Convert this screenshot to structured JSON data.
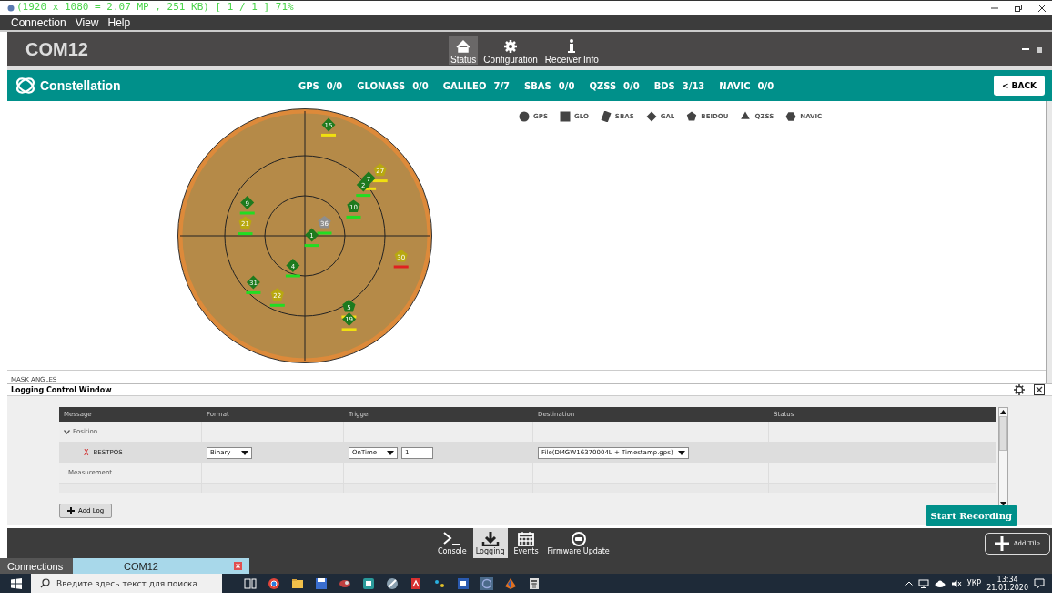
{
  "window": {
    "viewer_overlay": "(1920 x 1080 = 2.07 MP  ,  251 KB)  [ 1 / 1 ]  71%"
  },
  "menu": [
    "Connection",
    "View",
    "Help"
  ],
  "device": {
    "name": "COM12"
  },
  "nav": [
    {
      "label": "Status",
      "selected": true
    },
    {
      "label": "Configuration",
      "selected": false
    },
    {
      "label": "Receiver Info",
      "selected": false
    }
  ],
  "header": {
    "title": "Constellation",
    "back": "< BACK",
    "counts": [
      {
        "system": "GPS",
        "value": "0/0"
      },
      {
        "system": "GLONASS",
        "value": "0/0"
      },
      {
        "system": "GALILEO",
        "value": "7/7"
      },
      {
        "system": "SBAS",
        "value": "0/0"
      },
      {
        "system": "QZSS",
        "value": "0/0"
      },
      {
        "system": "BDS",
        "value": "3/13"
      },
      {
        "system": "NAVIC",
        "value": "0/0"
      }
    ]
  },
  "legend": [
    {
      "label": "GPS",
      "kind": "circle"
    },
    {
      "label": "GLO",
      "kind": "square"
    },
    {
      "label": "SBAS",
      "kind": "tilted"
    },
    {
      "label": "GAL",
      "kind": "diamond"
    },
    {
      "label": "BEIDOU",
      "kind": "pentagon"
    },
    {
      "label": "QZSS",
      "kind": "triangle"
    },
    {
      "label": "NAVIC",
      "kind": "hexagon"
    }
  ],
  "satellites": [
    {
      "label": "15",
      "kind": "diamond",
      "color": "#1e7a1e"
    },
    {
      "label": "27",
      "kind": "pentagon",
      "color": "#b8a810"
    },
    {
      "label": "7",
      "kind": "diamond",
      "color": "#1e7a1e"
    },
    {
      "label": "2",
      "kind": "diamond",
      "color": "#1e7a1e"
    },
    {
      "label": "10",
      "kind": "pentagon",
      "color": "#1e7a1e"
    },
    {
      "label": "9",
      "kind": "diamond",
      "color": "#1e7a1e"
    },
    {
      "label": "21",
      "kind": "pentagon",
      "color": "#b8a810"
    },
    {
      "label": "36",
      "kind": "pentagon",
      "color": "#8e8e8e"
    },
    {
      "label": "1",
      "kind": "diamond",
      "color": "#1e7a1e"
    },
    {
      "label": "30",
      "kind": "pentagon",
      "color": "#b8a810"
    },
    {
      "label": "4",
      "kind": "diamond",
      "color": "#1e7a1e"
    },
    {
      "label": "31",
      "kind": "diamond",
      "color": "#1e7a1e"
    },
    {
      "label": "22",
      "kind": "pentagon",
      "color": "#b8a810"
    },
    {
      "label": "5",
      "kind": "pentagon",
      "color": "#1e7a1e"
    },
    {
      "label": "19",
      "kind": "diamond",
      "color": "#1e7a1e"
    }
  ],
  "mask_angles": {
    "title": "MASK ANGLES"
  },
  "logging": {
    "title": "Logging Control Window",
    "columns": [
      "Message",
      "Format",
      "Trigger",
      "Destination",
      "Status"
    ],
    "rows": [
      {
        "kind": "group",
        "label": "Position",
        "expanded": true
      },
      {
        "kind": "log",
        "label": "BESTPOS",
        "remove": "X",
        "format": "Binary",
        "trigger": "OnTime",
        "period": "1",
        "destination": "File(DMGW16370004L + Timestamp.gps)"
      },
      {
        "kind": "group",
        "label": "Measurement",
        "expanded": false
      }
    ],
    "add_log": "Add Log",
    "start": "Start Recording"
  },
  "toolbar": [
    {
      "label": "Console",
      "selected": false
    },
    {
      "label": "Logging",
      "selected": true
    },
    {
      "label": "Events",
      "selected": false
    },
    {
      "label": "Firmware Update",
      "selected": false
    }
  ],
  "add_tile": "Add Tile",
  "tabs": [
    {
      "label": "Connections",
      "selected": false,
      "closable": false
    },
    {
      "label": "COM12",
      "selected": true,
      "closable": true
    }
  ],
  "taskbar": {
    "search_placeholder": "Введите здесь текст для поиска",
    "language": "УКР",
    "time": "13:34",
    "date": "21.01.2020"
  }
}
